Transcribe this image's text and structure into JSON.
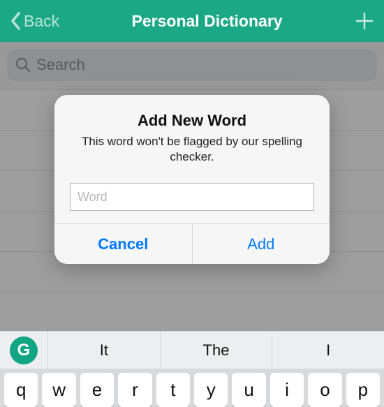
{
  "nav": {
    "back_label": "Back",
    "title": "Personal Dictionary"
  },
  "search": {
    "placeholder": "Search",
    "value": ""
  },
  "dialog": {
    "title": "Add New Word",
    "subtitle": "This word won't be flagged by our spelling checker.",
    "input_placeholder": "Word",
    "cancel_label": "Cancel",
    "add_label": "Add"
  },
  "suggestions": {
    "items": [
      "It",
      "The",
      "I"
    ]
  },
  "keyboard": {
    "row1": [
      "q",
      "w",
      "e",
      "r",
      "t",
      "y",
      "u",
      "i",
      "o",
      "p"
    ]
  },
  "icons": {
    "grammarly_initial": "G"
  }
}
